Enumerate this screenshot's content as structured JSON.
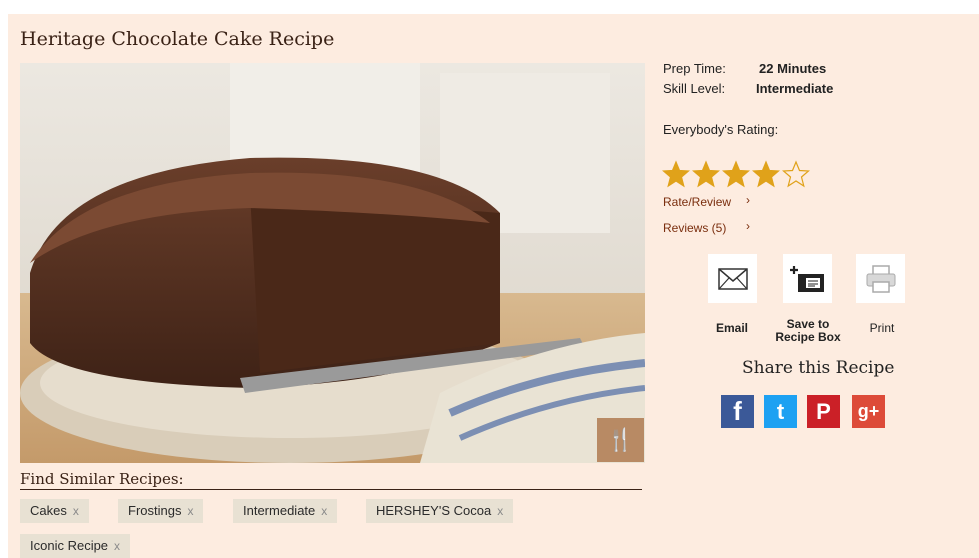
{
  "recipe": {
    "title": "Heritage Chocolate Cake Recipe",
    "prep_time_label": "Prep Time:",
    "prep_time_value": "22 Minutes",
    "skill_label": "Skill Level:",
    "skill_value": "Intermediate",
    "rating_label": "Everybody's Rating:",
    "rating": 4,
    "rating_max": 5,
    "rate_review_label": "Rate/Review",
    "reviews_label": "Reviews (5)"
  },
  "actions": {
    "email_label": "Email",
    "save_label_line1": "Save to",
    "save_label_line2": "Recipe Box",
    "print_label": "Print"
  },
  "share": {
    "title": "Share this Recipe",
    "networks": [
      "facebook",
      "twitter",
      "pinterest",
      "google-plus"
    ]
  },
  "similar": {
    "title": "Find Similar Recipes:",
    "remove_glyph": "x",
    "tags": [
      "Cakes",
      "Frostings",
      "Intermediate",
      "HERSHEY'S Cocoa",
      "Iconic Recipe"
    ]
  },
  "colors": {
    "background": "#fdece0",
    "link": "#7a2e0e",
    "star": "#e0a21a",
    "facebook": "#3b5998",
    "twitter": "#1da1f2",
    "pinterest": "#cb2027",
    "google_plus": "#dd4b39"
  }
}
